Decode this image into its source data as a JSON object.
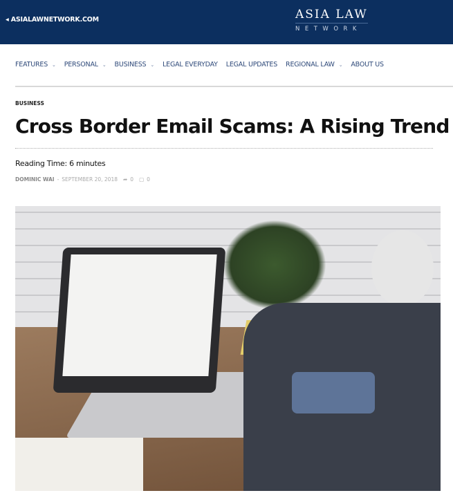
{
  "header": {
    "back_link": "ASIALAWNETWORK.COM",
    "logo_line1": "ASIA LAW",
    "logo_line2": "NETWORK",
    "bg": "#0c2f5f"
  },
  "nav": {
    "items": [
      {
        "label": "FEATURES",
        "dropdown": true
      },
      {
        "label": "PERSONAL",
        "dropdown": true
      },
      {
        "label": "BUSINESS",
        "dropdown": true
      },
      {
        "label": "LEGAL EVERYDAY",
        "dropdown": false
      },
      {
        "label": "LEGAL UPDATES",
        "dropdown": false
      },
      {
        "label": "REGIONAL LAW",
        "dropdown": true
      },
      {
        "label": "ABOUT US",
        "dropdown": false
      }
    ]
  },
  "article": {
    "category": "BUSINESS",
    "title": "Cross Border Email Scams: A Rising Trend",
    "reading_time": "Reading Time: 6 minutes",
    "author": "DOMINIC WAI",
    "separator": "-",
    "date": "SEPTEMBER 20, 2018",
    "shares": "0",
    "comments": "0"
  }
}
